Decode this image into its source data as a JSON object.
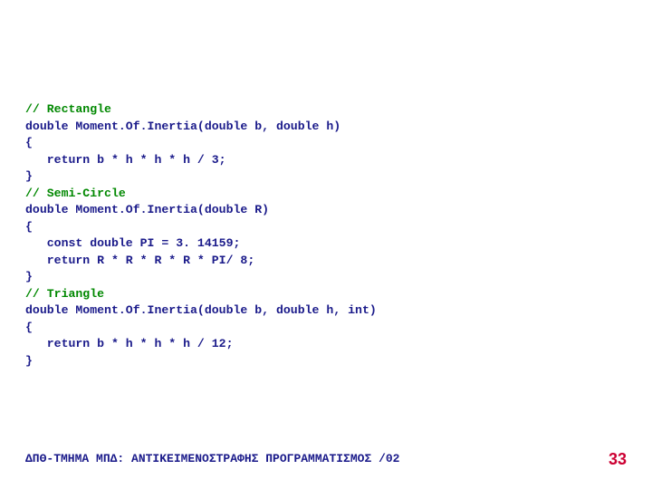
{
  "code": {
    "l1": "// Rectangle",
    "l2": "double Moment.Of.Inertia(double b, double h)",
    "l3": "{",
    "l4": "   return b * h * h * h / 3;",
    "l5": "}",
    "l6": "",
    "l7": "// Semi-Circle",
    "l8": "double Moment.Of.Inertia(double R)",
    "l9": "{",
    "l10": "   const double PI = 3. 14159;",
    "l11": "",
    "l12": "   return R * R * R * R * PI/ 8;",
    "l13": "}",
    "l14": "// Triangle",
    "l15": "double Moment.Of.Inertia(double b, double h, int)",
    "l16": "{",
    "l17": "   return b * h * h * h / 12;",
    "l18": "}"
  },
  "footer_text": "ΔΠΘ-ΤΜΗΜΑ ΜΠΔ: ΑΝΤΙΚΕΙΜΕΝΟΣΤΡΑΦΗΣ ΠΡΟΓΡΑΜΜΑΤΙΣΜΟΣ /02",
  "page_number": "33"
}
